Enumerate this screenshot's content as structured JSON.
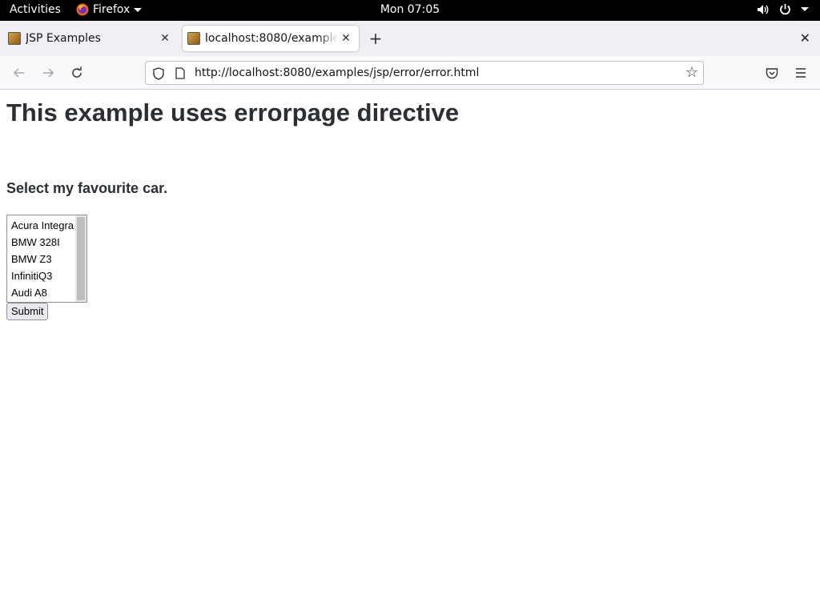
{
  "topbar": {
    "activities": "Activities",
    "app_name": "Firefox",
    "clock": "Mon 07:05"
  },
  "tabs": [
    {
      "title": "JSP Examples",
      "active": false
    },
    {
      "title": "localhost:8080/examples/jsp/error/error.html",
      "active": true
    }
  ],
  "navbar": {
    "url": "http://localhost:8080/examples/jsp/error/error.html"
  },
  "page": {
    "title": "This example uses errorpage directive",
    "subtitle": "Select my favourite car.",
    "car_options": [
      "Acura Integra",
      "BMW 328I",
      "BMW Z3",
      "InfinitiQ3",
      "Audi A8"
    ],
    "submit_label": "Submit"
  },
  "colors": {
    "topbar_bg": "#000000",
    "tabstrip_bg": "#f0f0f4",
    "heading_text": "#2b2f33"
  }
}
